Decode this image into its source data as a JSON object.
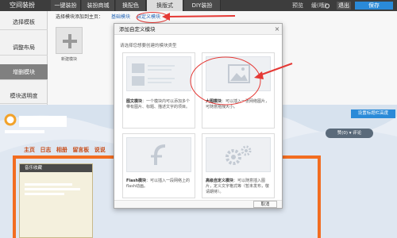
{
  "topbar": {
    "logo": "空间装扮",
    "tabs": [
      "一键装扮",
      "装扮商城",
      "换配色",
      "换版式",
      "DIY装扮"
    ],
    "active_tab": 3,
    "preview": "预览",
    "account": "缓(哦)",
    "exit": "退出",
    "save": "保存"
  },
  "sidebar": {
    "items": [
      "选择模板",
      "调整布局",
      "增删模块",
      "模块透明度"
    ],
    "active": 2
  },
  "panel": {
    "hint": "选择模块添加到主页：",
    "link_normal": "基础模块",
    "link_custom": "自定义模块",
    "add_label": "新建模块"
  },
  "page": {
    "nav": [
      "主页",
      "日志",
      "相册",
      "留言板",
      "说说"
    ],
    "section_title": "音乐收藏",
    "right_button": "设置标题栏高度",
    "stats": "赞(0)  ▾  评论"
  },
  "modal": {
    "title": "添加自定义模块",
    "subtitle": "请选择您想要创建的模块类型",
    "options": [
      {
        "name": "图文模块",
        "desc": "：一个模块内可以添加多个带有图片、标题、描述文字的项目。"
      },
      {
        "name": "大图模块",
        "desc": "：可以插入一张网络图片，可随意拖拽大小。"
      },
      {
        "name": "Flash模块",
        "desc": "：可以插入一段网络上的flash动画。"
      },
      {
        "name": "高级自定义模块",
        "desc": "：可以随意插入图片，定义文字格式等（暂未发布，敬请期待）。"
      }
    ],
    "cancel": "取消"
  },
  "colors": {
    "accent": "#2a8ad8",
    "highlight": "#e53935",
    "topbar": "#3d3d3d",
    "frame": "#f26d21"
  }
}
